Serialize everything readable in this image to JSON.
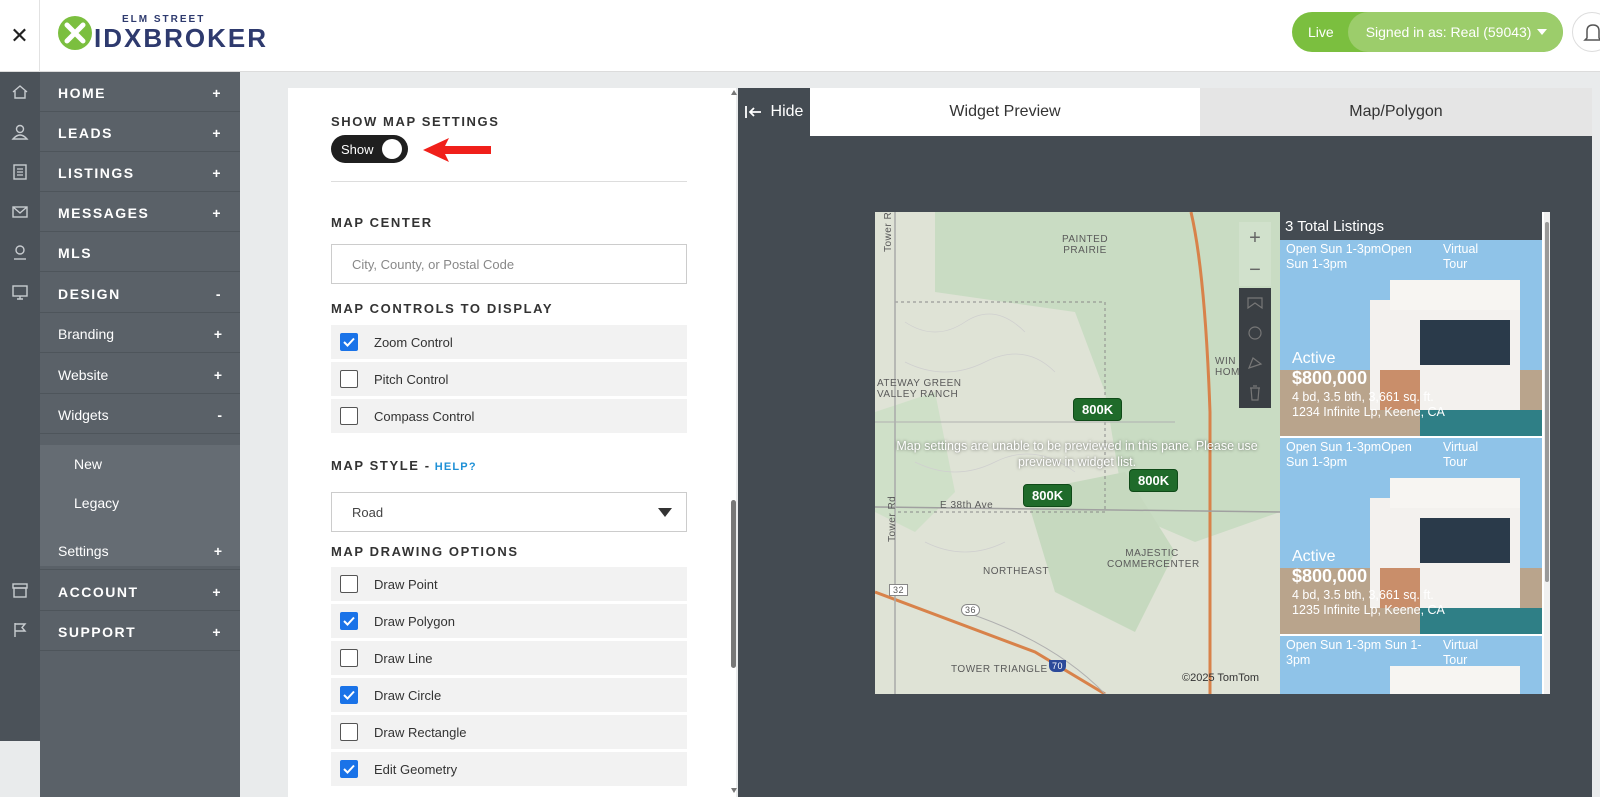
{
  "header": {
    "close_glyph": "✕",
    "logo_top": "ELM STREET",
    "logo_main": "IDXBROKER",
    "live_label": "Live",
    "signed_in": "Signed in as: Real (59043)"
  },
  "rail_icons": [
    "home-icon",
    "user-icon",
    "listings-icon",
    "mail-icon",
    "map-pin-icon",
    "monitor-icon",
    "archive-icon",
    "flag-icon"
  ],
  "sidebar": {
    "items": [
      {
        "label": "HOME",
        "sign": "+"
      },
      {
        "label": "LEADS",
        "sign": "+"
      },
      {
        "label": "LISTINGS",
        "sign": "+"
      },
      {
        "label": "MESSAGES",
        "sign": "+"
      },
      {
        "label": "MLS",
        "sign": ""
      },
      {
        "label": "DESIGN",
        "sign": "-"
      },
      {
        "label": "Branding",
        "sign": "+"
      },
      {
        "label": "Website",
        "sign": "+"
      },
      {
        "label": "Widgets",
        "sign": "-"
      },
      {
        "label": "New",
        "sign": ""
      },
      {
        "label": "Legacy",
        "sign": ""
      },
      {
        "label": "Settings",
        "sign": "+"
      },
      {
        "label": "ACCOUNT",
        "sign": "+"
      },
      {
        "label": "SUPPORT",
        "sign": "+"
      }
    ]
  },
  "settings": {
    "show_map_title": "SHOW MAP SETTINGS",
    "toggle_label": "Show",
    "map_center_title": "MAP CENTER",
    "map_center_placeholder": "City, County, or Postal Code",
    "controls_title": "MAP CONTROLS TO DISPLAY",
    "controls": [
      {
        "label": "Zoom Control",
        "checked": true
      },
      {
        "label": "Pitch Control",
        "checked": false
      },
      {
        "label": "Compass Control",
        "checked": false
      }
    ],
    "style_title": "MAP STYLE -",
    "style_help": "HELP?",
    "style_value": "Road",
    "drawing_title": "MAP DRAWING OPTIONS",
    "drawing": [
      {
        "label": "Draw Point",
        "checked": false
      },
      {
        "label": "Draw Polygon",
        "checked": true
      },
      {
        "label": "Draw Line",
        "checked": false
      },
      {
        "label": "Draw Circle",
        "checked": true
      },
      {
        "label": "Draw Rectangle",
        "checked": false
      },
      {
        "label": "Edit Geometry",
        "checked": true
      }
    ]
  },
  "preview": {
    "hide_label": "Hide",
    "tab_widget": "Widget Preview",
    "tab_map": "Map/Polygon",
    "map_message": "Map settings are unable to be previewed in this pane. Please use preview in widget list.",
    "map_labels": [
      "PAINTED PRAIRIE",
      "Tower Rd",
      "ATEWAY GREEN VALLEY RANCH",
      "E 38th Ave",
      "Tower Rd",
      "NORTHEAST",
      "MAJESTIC COMMERCENTER",
      "TOWER TRIANGLE",
      "WIN HOME"
    ],
    "road_shields": [
      "32",
      "36",
      "70"
    ],
    "pins": [
      "800K",
      "800K",
      "800K"
    ],
    "zoom_in": "+",
    "zoom_out": "−",
    "copyright": "©2025 TomTom",
    "total_listings": "3 Total Listings",
    "listings": [
      {
        "open_house": "Open Sun 1-3pmOpen Sun 1-3pm",
        "tour": "Virtual Tour",
        "status": "Active",
        "price": "$800,000",
        "beds": "4 bd, 3.5 bth, 3,661 sq. ft.",
        "addr": "1234 Infinite Lp, Keene, CA"
      },
      {
        "open_house": "Open Sun 1-3pmOpen Sun 1-3pm",
        "tour": "Virtual Tour",
        "status": "Active",
        "price": "$800,000",
        "beds": "4 bd, 3.5 bth, 3,661 sq. ft.",
        "addr": "1235 Infinite Lp, Keene, CA"
      },
      {
        "open_house": "Open Sun 1-3pm Sun 1-3pm",
        "tour": "Virtual Tour",
        "status": "",
        "price": "",
        "beds": "",
        "addr": ""
      }
    ]
  },
  "colors": {
    "brand_green": "#7bbf3f",
    "sidebar": "#5a6168",
    "rail": "#4b5259",
    "checkbox_blue": "#1a73e8",
    "pin_green": "#1f6b2a"
  }
}
